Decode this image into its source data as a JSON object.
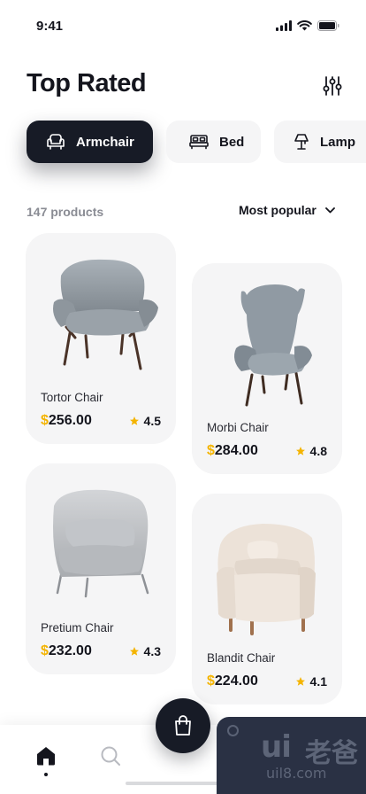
{
  "status_bar": {
    "time": "9:41",
    "icons": [
      "signal-icon",
      "wifi-icon",
      "battery-icon"
    ]
  },
  "header": {
    "title": "Top Rated",
    "filter_icon": "sliders-icon"
  },
  "categories": [
    {
      "label": "Armchair",
      "icon": "armchair-icon",
      "active": true
    },
    {
      "label": "Bed",
      "icon": "bed-icon",
      "active": false
    },
    {
      "label": "Lamp",
      "icon": "lamp-icon",
      "active": false
    }
  ],
  "listing": {
    "count_text": "147 products",
    "sort_label": "Most popular"
  },
  "products": [
    {
      "name": "Tortor Chair",
      "currency": "$",
      "price": "256.00",
      "rating": "4.5"
    },
    {
      "name": "Morbi Chair",
      "currency": "$",
      "price": "284.00",
      "rating": "4.8"
    },
    {
      "name": "Pretium Chair",
      "currency": "$",
      "price": "232.00",
      "rating": "4.3"
    },
    {
      "name": "Blandit Chair",
      "currency": "$",
      "price": "224.00",
      "rating": "4.1"
    }
  ],
  "bottom_nav": {
    "items": [
      "home-icon",
      "search-icon"
    ],
    "cart_icon": "shopping-bag-icon"
  },
  "watermark": {
    "brand": "ui",
    "brand_cn": "老爸",
    "url": "uil8.com"
  },
  "colors": {
    "accent_dark": "#171b26",
    "star": "#f4b400",
    "card_bg": "#f5f5f6",
    "muted_text": "#8a8c94"
  }
}
